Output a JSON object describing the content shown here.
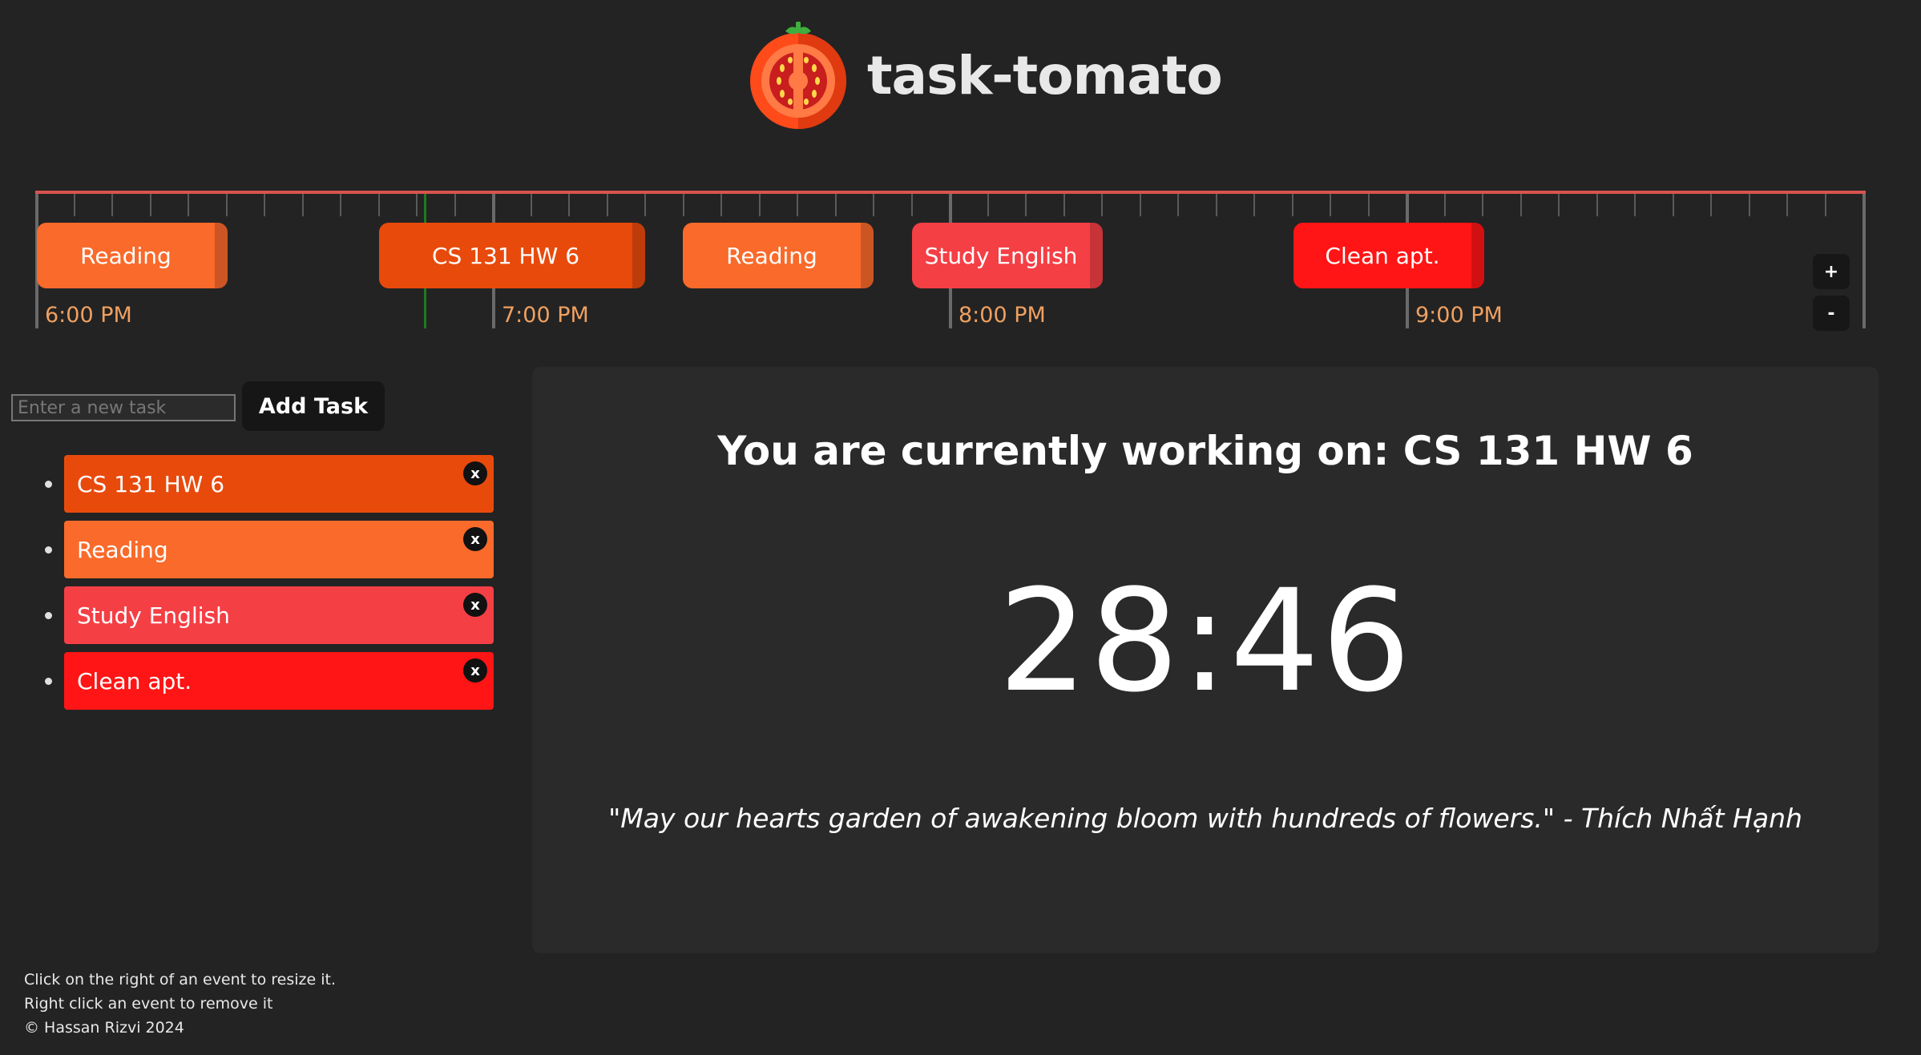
{
  "app": {
    "title": "task-tomato"
  },
  "timeline": {
    "hours": [
      "6:00 PM",
      "7:00 PM",
      "8:00 PM",
      "9:00 PM"
    ],
    "events": [
      {
        "label": "Reading",
        "color": "#f96a2b"
      },
      {
        "label": "CS 131 HW 6",
        "color": "#e84a0c"
      },
      {
        "label": "Reading",
        "color": "#f96a2b"
      },
      {
        "label": "Study English",
        "color": "#f43f45"
      },
      {
        "label": "Clean apt.",
        "color": "#ff1515"
      }
    ],
    "zoom_in_label": "+",
    "zoom_out_label": "-"
  },
  "task_panel": {
    "input_placeholder": "Enter a new task",
    "add_button_label": "Add Task",
    "remove_label": "x",
    "tasks": [
      {
        "label": "CS 131 HW 6",
        "color": "#e84a0c"
      },
      {
        "label": "Reading",
        "color": "#f96a2b"
      },
      {
        "label": "Study English",
        "color": "#f43f45"
      },
      {
        "label": "Clean apt.",
        "color": "#ff1515"
      }
    ]
  },
  "main": {
    "current_task": "You are currently working on: CS 131 HW 6",
    "timer": "28:46",
    "quote": "\"May our hearts garden of awakening bloom with hundreds of flowers.\" - Thích Nhất Hạnh"
  },
  "footer": {
    "line1": "Click on the right of an event to resize it.",
    "line2": "Right click an event to remove it",
    "line3": "© Hassan Rizvi 2024"
  }
}
